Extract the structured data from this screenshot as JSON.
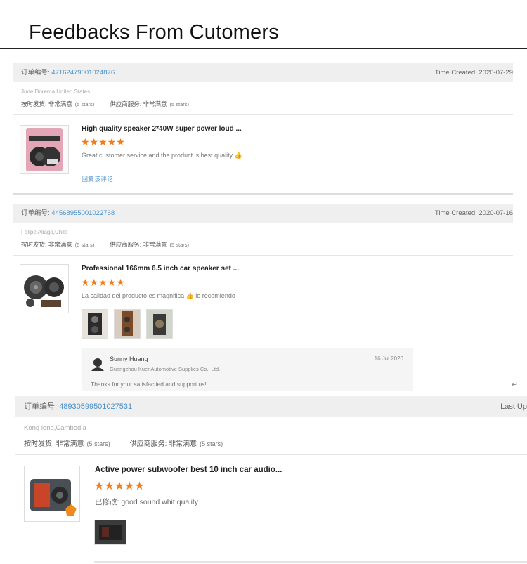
{
  "page": {
    "title": "Feedbacks From Cutomers"
  },
  "feedbacks": [
    {
      "order_label": "订单编号:",
      "order_no": "47162479001024876",
      "time_label": "Time Created: 2020-07-29",
      "location": "Jude Dorema,United States",
      "ship_label": "按时发货: 非常满意",
      "ship_stars": "(5 stars)",
      "service_label": "供应商服务: 非常满意",
      "service_stars": "(5 stars)",
      "product_title": "High quality speaker 2*40W super power loud ...",
      "rating": 5,
      "stars": "★★★★★",
      "comment": "Great customer service and the product is best quality 👍.",
      "reply_link": "回复该评论"
    },
    {
      "order_label": "订单编号:",
      "order_no": "44568955001022768",
      "time_label": "Time Created: 2020-07-16",
      "location": "Felipe Aliaga,Chile",
      "ship_label": "按时发货: 非常满意",
      "ship_stars": "(5 stars)",
      "service_label": "供应商服务: 非常满意",
      "service_stars": "(5 stars)",
      "product_title": "Professional 166mm 6.5 inch car speaker set ...",
      "rating": 5,
      "stars": "★★★★★",
      "comment": "La calidad del producto es magnifica 👍 lo recomiendo",
      "reply": {
        "name": "Sunny Huang",
        "company": "Guangzhou Kuer Automotive Supplies Co., Ltd.",
        "date": "16 Jul 2020",
        "text": "Thanks for  your satisfactied and support us!"
      },
      "return_icon": "↵"
    },
    {
      "order_label": "订单编号:",
      "order_no": "48930599501027531",
      "time_label": "Last Up",
      "location": "Kong leng,Cambodia",
      "ship_label": "按时发货: 非常满意",
      "ship_stars": "(5 stars)",
      "service_label": "供应商服务: 非常满意",
      "service_stars": "(5 stars)",
      "product_title": "Active power subwoofer best 10 inch car audio...",
      "rating": 5,
      "stars": "★★★★★",
      "comment": "已修改: good sound whit quality"
    }
  ],
  "colors": {
    "accent": "#4a90c8",
    "star": "#f07d1a",
    "header_bg": "#efefef"
  }
}
